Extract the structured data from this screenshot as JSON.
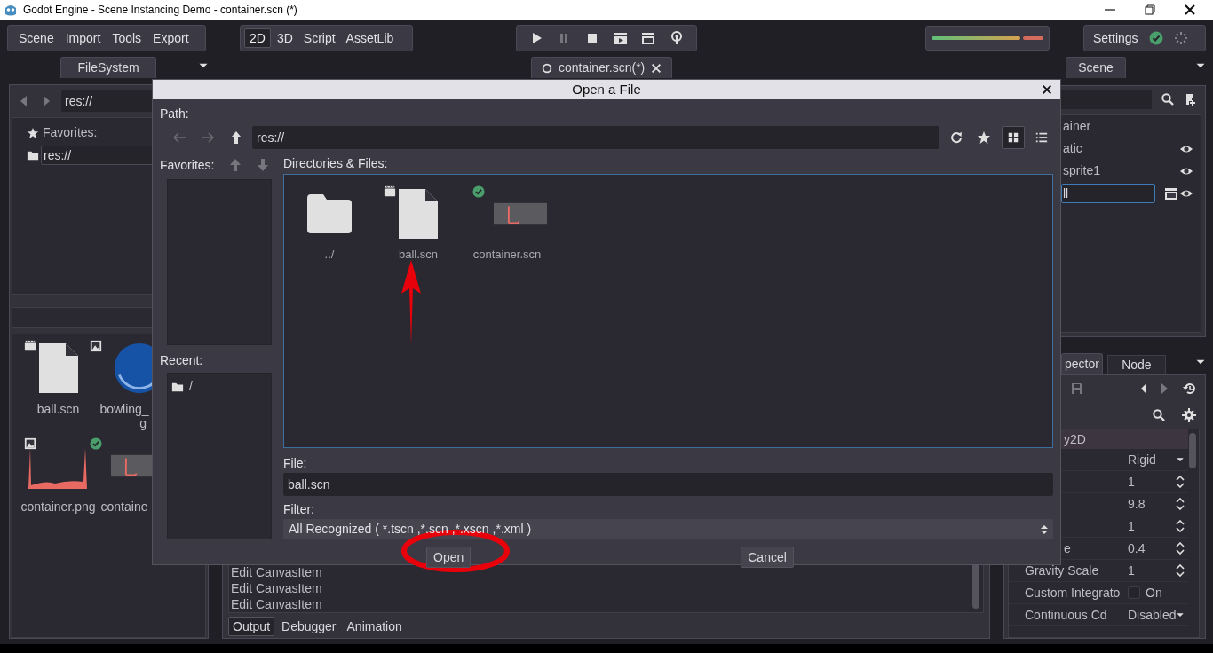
{
  "window": {
    "title": "Godot Engine - Scene Instancing Demo - container.scn (*)"
  },
  "menus": [
    "Scene",
    "Import",
    "Tools",
    "Export"
  ],
  "workspaces": [
    {
      "label": "2D",
      "selected": true
    },
    {
      "label": "3D",
      "selected": false
    },
    {
      "label": "Script",
      "selected": false
    },
    {
      "label": "AssetLib",
      "selected": false
    }
  ],
  "settings": "Settings",
  "filesystem": {
    "tab": "FileSystem",
    "path": "res://",
    "favorites_label": "Favorites:",
    "favorites": [
      "res://"
    ],
    "files": [
      {
        "lines": [
          "ball.scn"
        ],
        "kind": "scene"
      },
      {
        "lines": [
          "bowling_",
          "g"
        ],
        "kind": "ball_image"
      },
      {
        "lines": [
          "container.png"
        ],
        "kind": "plot_image"
      },
      {
        "lines": [
          "containe"
        ],
        "kind": "scene_thumb"
      }
    ]
  },
  "editor_tabs": [
    {
      "label": "container.scn(*)",
      "selected": true
    }
  ],
  "scene_dock": {
    "tab": "Scene",
    "nodes": [
      {
        "label": "ainer",
        "kind": "root"
      },
      {
        "label": "atic",
        "kind": "node"
      },
      {
        "label": "sprite1",
        "kind": "node"
      },
      {
        "label": "ll",
        "kind": "editing"
      }
    ]
  },
  "inspector": {
    "tabs": [
      {
        "label": "pector",
        "selected": true
      },
      {
        "label": "Node",
        "selected": false
      }
    ],
    "section": "y2D",
    "properties": [
      {
        "value": "Rigid",
        "kind": "enum"
      },
      {
        "value": "1",
        "kind": "number"
      },
      {
        "value": "9.8",
        "kind": "number"
      },
      {
        "value": "1",
        "kind": "number"
      },
      {
        "name": "e",
        "value": "0.4",
        "kind": "number"
      },
      {
        "name": "Gravity Scale",
        "value": "1",
        "kind": "number"
      },
      {
        "name": "Custom Integrato",
        "value": "On",
        "kind": "check",
        "checked": false
      },
      {
        "name": "Continuous Cd",
        "value": "Disabled",
        "kind": "enum"
      }
    ]
  },
  "output": {
    "lines": [
      "Edit CanvasItem",
      "Edit CanvasItem",
      "Edit CanvasItem"
    ],
    "tabs": [
      {
        "label": "Output",
        "selected": true
      },
      {
        "label": "Debugger",
        "selected": false
      },
      {
        "label": "Animation",
        "selected": false
      }
    ]
  },
  "dialog": {
    "title": "Open a File",
    "path_label": "Path:",
    "path": "res://",
    "view_buttons": [
      {
        "kind": "grid",
        "selected": true
      },
      {
        "kind": "list",
        "selected": false
      }
    ],
    "favorites_label": "Favorites:",
    "recent_label": "Recent:",
    "recent": [
      "/"
    ],
    "files_label": "Directories & Files:",
    "items": [
      {
        "name": "../",
        "kind": "folder"
      },
      {
        "name": "ball.scn",
        "kind": "scene"
      },
      {
        "name": "container.scn",
        "kind": "scene_thumb"
      }
    ],
    "file_label": "File:",
    "file": "ball.scn",
    "filter_label": "Filter:",
    "filter": "All Recognized ( *.tscn ,*.scn ,*.xscn ,*.xml  )",
    "buttons": [
      "Open",
      "Cancel"
    ]
  }
}
